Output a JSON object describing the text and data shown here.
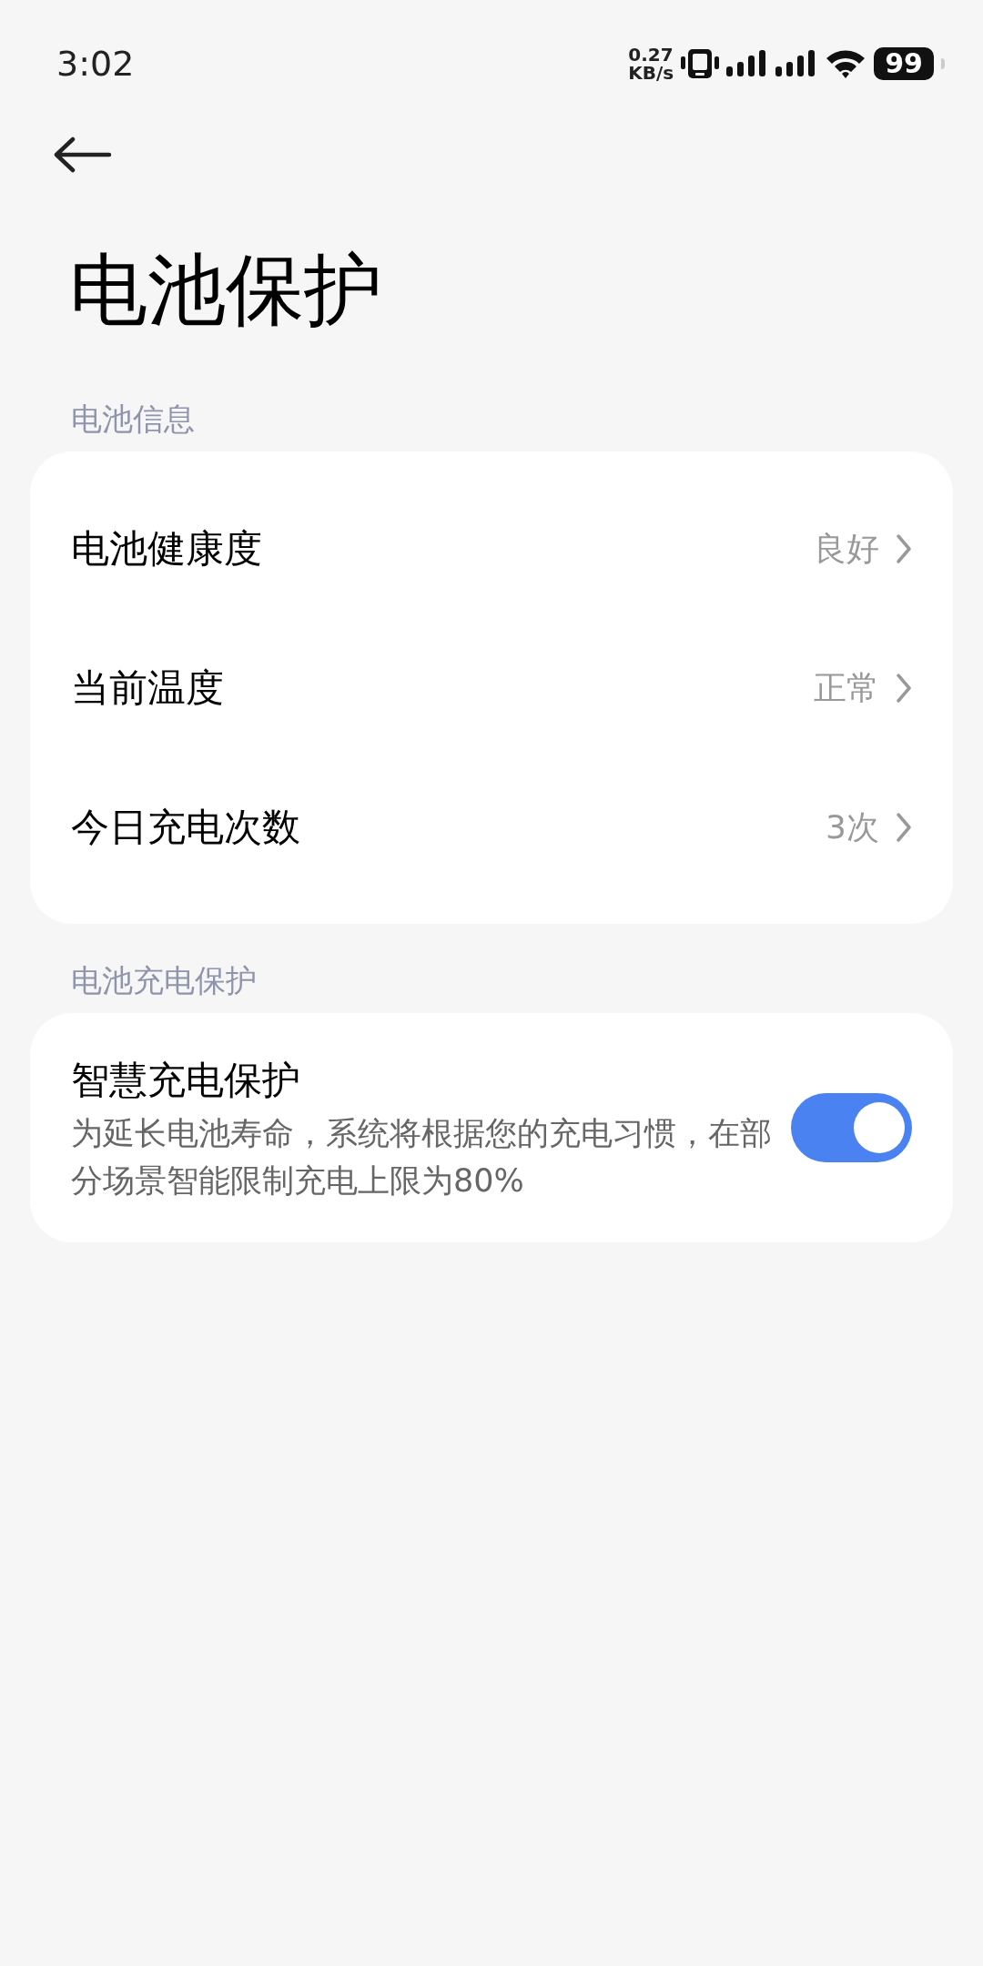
{
  "status_bar": {
    "time": "3:02",
    "net_speed": "0.27",
    "net_unit": "KB/s",
    "battery": "99"
  },
  "title": "电池保护",
  "sections": [
    {
      "header": "电池信息",
      "items": [
        {
          "kind": "link",
          "label": "电池健康度",
          "value": "良好"
        },
        {
          "kind": "link",
          "label": "当前温度",
          "value": "正常"
        },
        {
          "kind": "link",
          "label": "今日充电次数",
          "value": "3次"
        }
      ]
    },
    {
      "header": "电池充电保护",
      "items": [
        {
          "kind": "toggle",
          "label": "智慧充电保护",
          "description": "为延长电池寿命，系统将根据您的充电习惯，在部分场景智能限制充电上限为80%",
          "on": true
        }
      ]
    }
  ]
}
